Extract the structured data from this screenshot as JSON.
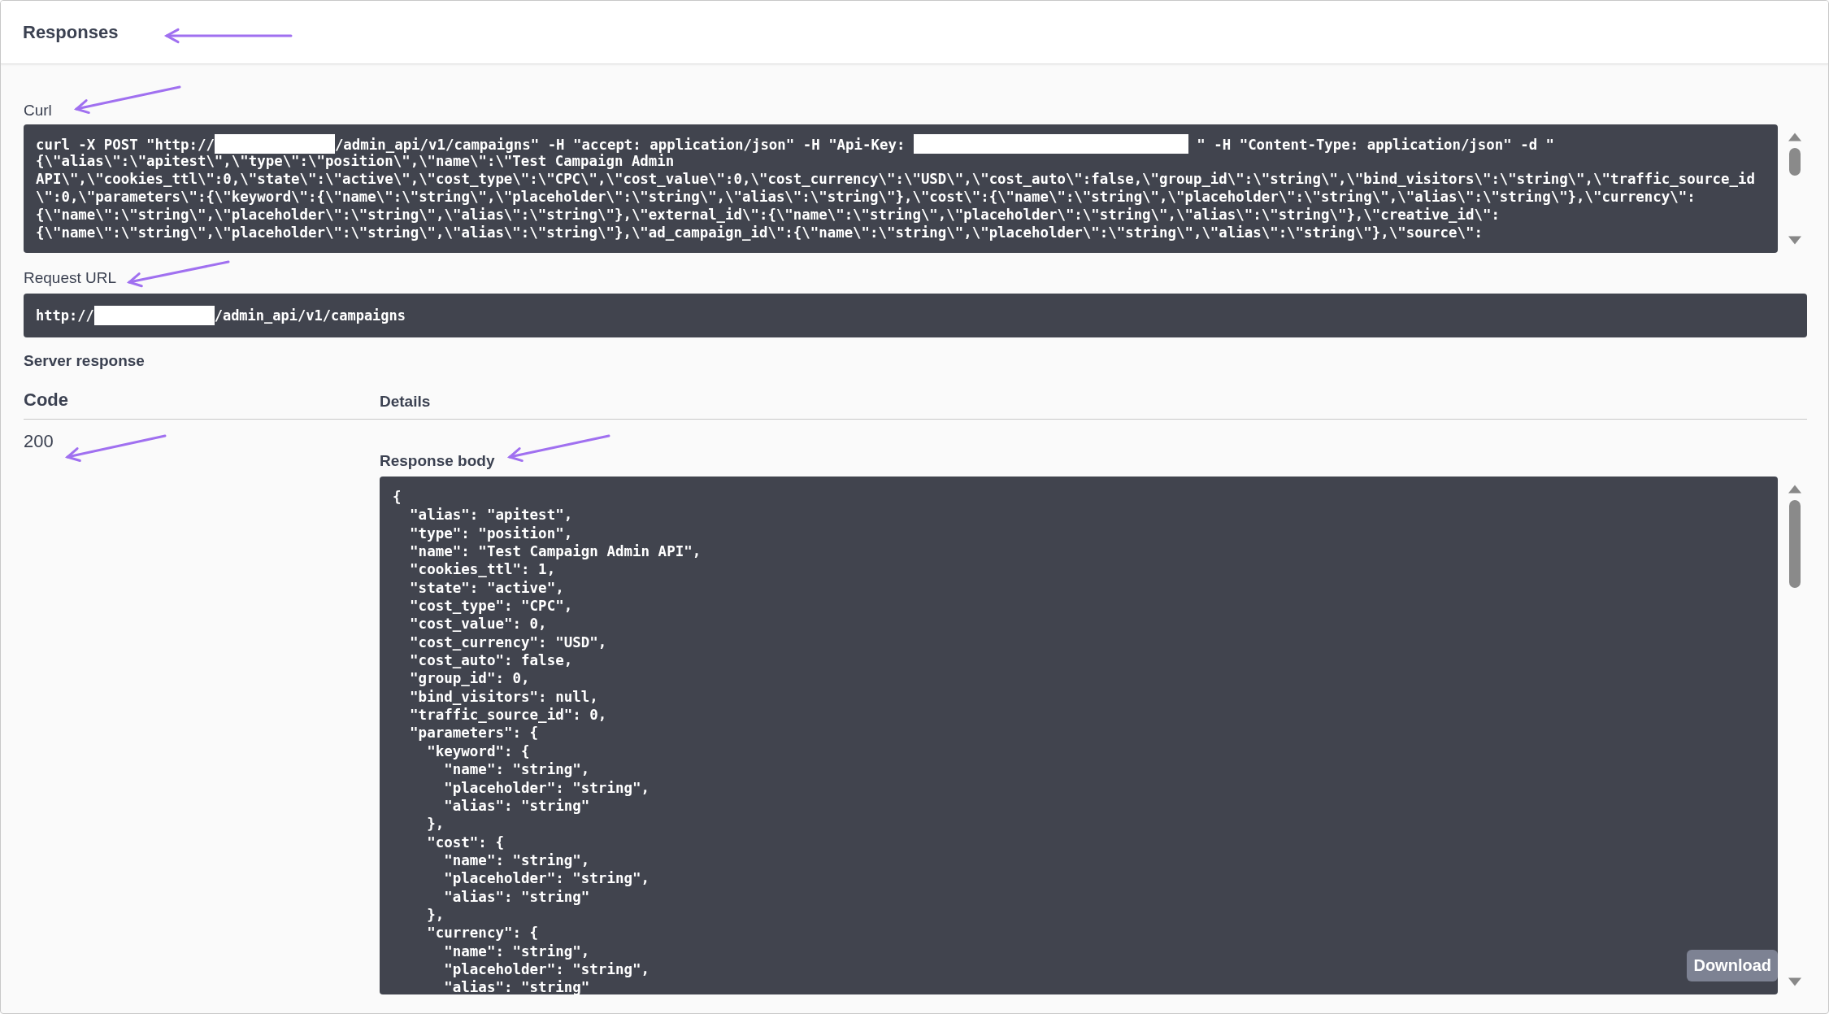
{
  "section_title": "Responses",
  "curl": {
    "label": "Curl",
    "lines": [
      [
        {
          "kind": "text",
          "text": "curl -X POST \"http://"
        },
        {
          "kind": "redacted"
        },
        {
          "kind": "text",
          "text": "/admin_api/v1/campaigns\" -H \"accept: application/json\" -H \"Api-Key: "
        },
        {
          "kind": "redacted"
        },
        {
          "kind": "text",
          "text": " \" -H \"Content-Type: application/json\" -d \""
        }
      ],
      [
        {
          "kind": "text",
          "text": "{\\\"alias\\\":\\\"apitest\\\",\\\"type\\\":\\\"position\\\",\\\"name\\\":\\\"Test Campaign Admin"
        }
      ],
      [
        {
          "kind": "text",
          "text": "API\\\",\\\"cookies_ttl\\\":0,\\\"state\\\":\\\"active\\\",\\\"cost_type\\\":\\\"CPC\\\",\\\"cost_value\\\":0,\\\"cost_currency\\\":\\\"USD\\\",\\\"cost_auto\\\":false,\\\"group_id\\\":\\\"string\\\",\\\"bind_visitors\\\":\\\"string\\\",\\\"traffic_source_id"
        }
      ],
      [
        {
          "kind": "text",
          "text": "\\\":0,\\\"parameters\\\":{\\\"keyword\\\":{\\\"name\\\":\\\"string\\\",\\\"placeholder\\\":\\\"string\\\",\\\"alias\\\":\\\"string\\\"},\\\"cost\\\":{\\\"name\\\":\\\"string\\\",\\\"placeholder\\\":\\\"string\\\",\\\"alias\\\":\\\"string\\\"},\\\"currency\\\":"
        }
      ],
      [
        {
          "kind": "text",
          "text": "{\\\"name\\\":\\\"string\\\",\\\"placeholder\\\":\\\"string\\\",\\\"alias\\\":\\\"string\\\"},\\\"external_id\\\":{\\\"name\\\":\\\"string\\\",\\\"placeholder\\\":\\\"string\\\",\\\"alias\\\":\\\"string\\\"},\\\"creative_id\\\":"
        }
      ],
      [
        {
          "kind": "text",
          "text": "{\\\"name\\\":\\\"string\\\",\\\"placeholder\\\":\\\"string\\\",\\\"alias\\\":\\\"string\\\"},\\\"ad_campaign_id\\\":{\\\"name\\\":\\\"string\\\",\\\"placeholder\\\":\\\"string\\\",\\\"alias\\\":\\\"string\\\"},\\\"source\\\":"
        }
      ]
    ]
  },
  "request_url": {
    "label": "Request URL",
    "parts": [
      {
        "kind": "text",
        "text": "http://"
      },
      {
        "kind": "redacted"
      },
      {
        "kind": "text",
        "text": "/admin_api/v1/campaigns"
      }
    ]
  },
  "server_response": {
    "label": "Server response",
    "columns": [
      "Code",
      "Details"
    ],
    "code": "200",
    "body_label": "Response body",
    "body_lines": [
      "{",
      "  \"alias\": \"apitest\",",
      "  \"type\": \"position\",",
      "  \"name\": \"Test Campaign Admin API\",",
      "  \"cookies_ttl\": 1,",
      "  \"state\": \"active\",",
      "  \"cost_type\": \"CPC\",",
      "  \"cost_value\": 0,",
      "  \"cost_currency\": \"USD\",",
      "  \"cost_auto\": false,",
      "  \"group_id\": 0,",
      "  \"bind_visitors\": null,",
      "  \"traffic_source_id\": 0,",
      "  \"parameters\": {",
      "    \"keyword\": {",
      "      \"name\": \"string\",",
      "      \"placeholder\": \"string\",",
      "      \"alias\": \"string\"",
      "    },",
      "    \"cost\": {",
      "      \"name\": \"string\",",
      "      \"placeholder\": \"string\",",
      "      \"alias\": \"string\"",
      "    },",
      "    \"currency\": {",
      "      \"name\": \"string\",",
      "      \"placeholder\": \"string\",",
      "      \"alias\": \"string\""
    ],
    "download": "Download"
  }
}
